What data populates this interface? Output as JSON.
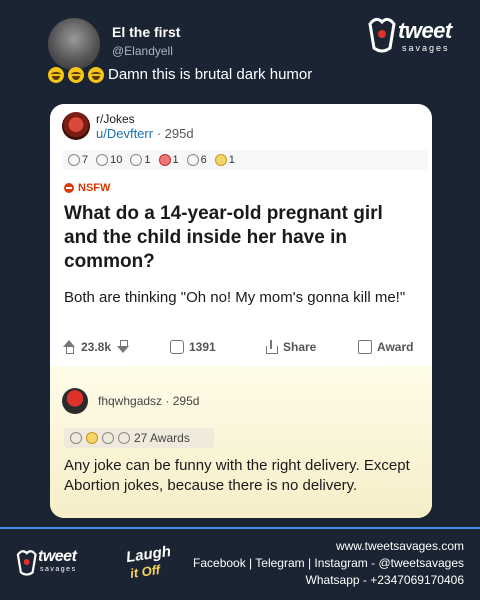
{
  "tweet": {
    "name": "El the first",
    "handle": "@Elandyell",
    "text": "Damn this is brutal dark humor"
  },
  "brand": {
    "word": "tweet",
    "sub": "savages"
  },
  "post": {
    "subreddit": "r/Jokes",
    "user": "u/Devfterr",
    "age": "295d",
    "awards": [
      {
        "icon": "silver-award-icon",
        "count": "7"
      },
      {
        "icon": "helpful-award-icon",
        "count": "10"
      },
      {
        "icon": "wholesome-award-icon",
        "count": "1"
      },
      {
        "icon": "rocket-award-icon",
        "count": "1"
      },
      {
        "icon": "s-award-icon",
        "count": "6"
      },
      {
        "icon": "gold-award-icon",
        "count": "1"
      }
    ],
    "nsfw": "NSFW",
    "title": "What do a 14-year-old pregnant girl and the child inside her have in common?",
    "body": "Both are thinking \"Oh no! My mom's gonna kill me!\"",
    "upvotes": "23.8k",
    "comments": "1391",
    "share": "Share",
    "award": "Award"
  },
  "comment": {
    "user": "fhqwhgadsz",
    "age": "295d",
    "awards_label": "27 Awards",
    "text": "Any joke can be funny with the right delivery. Except Abortion jokes, because there is no delivery."
  },
  "footer": {
    "laugh_1": "Laugh",
    "laugh_2": "it Off",
    "website": "www.tweetsavages.com",
    "socials": "Facebook | Telegram | Instagram - @tweetsavages",
    "whatsapp": "Whatsapp - +2347069170406"
  },
  "colors": {
    "background": "#1b2433",
    "accent": "#3a8ee6",
    "nsfw": "#d93a00",
    "link": "#1a6fb0"
  }
}
